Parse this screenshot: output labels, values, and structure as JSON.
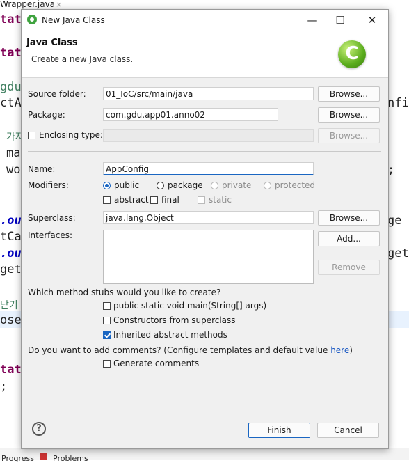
{
  "background": {
    "tab_label": "Wrapper.java",
    "tab_close": "×",
    "code_fragments": [
      "tat",
      "tat",
      "gdu",
      "ctA",
      "가자",
      "ma",
      "wo",
      ".ou",
      "tCa",
      ".ou",
      "get",
      "닫기",
      "ose",
      "tat",
      ";",
      "nfi",
      ";",
      "ge",
      "get"
    ],
    "bottom_tabs": [
      "Progress",
      "Problems"
    ]
  },
  "dialog": {
    "title": "New Java Class",
    "window_controls": {
      "minimize": "—",
      "maximize": "☐",
      "close": "✕"
    },
    "header": {
      "title": "Java Class",
      "description": "Create a new Java class.",
      "logo_glyph": "C"
    },
    "form": {
      "source_folder": {
        "label": "Source folder:",
        "value": "01_IoC/src/main/java",
        "button": "Browse..."
      },
      "package": {
        "label": "Package:",
        "value": "com.gdu.app01.anno02",
        "button": "Browse..."
      },
      "enclosing_type": {
        "label": "Enclosing type:",
        "value": "",
        "button": "Browse...",
        "checked": false
      },
      "name": {
        "label": "Name:",
        "value": "AppConfig"
      },
      "modifiers": {
        "label": "Modifiers:",
        "access": [
          "public",
          "package",
          "private",
          "protected"
        ],
        "selected": "public",
        "flags": [
          "abstract",
          "final",
          "static"
        ]
      },
      "superclass": {
        "label": "Superclass:",
        "value": "java.lang.Object",
        "button": "Browse..."
      },
      "interfaces": {
        "label": "Interfaces:",
        "add_button": "Add...",
        "remove_button": "Remove"
      },
      "stubs": {
        "question": "Which method stubs would you like to create?",
        "options": [
          {
            "label": "public static void main(String[] args)",
            "checked": false
          },
          {
            "label": "Constructors from superclass",
            "checked": false
          },
          {
            "label": "Inherited abstract methods",
            "checked": true
          }
        ]
      },
      "comments": {
        "question_prefix": "Do you want to add comments? (Configure templates and default value ",
        "link": "here",
        "question_suffix": ")",
        "option": "Generate comments",
        "checked": false
      }
    },
    "footer": {
      "help": "?",
      "finish": "Finish",
      "cancel": "Cancel"
    }
  },
  "colors": {
    "accent": "#1a66c2",
    "logo_green": "#5aac1c"
  }
}
